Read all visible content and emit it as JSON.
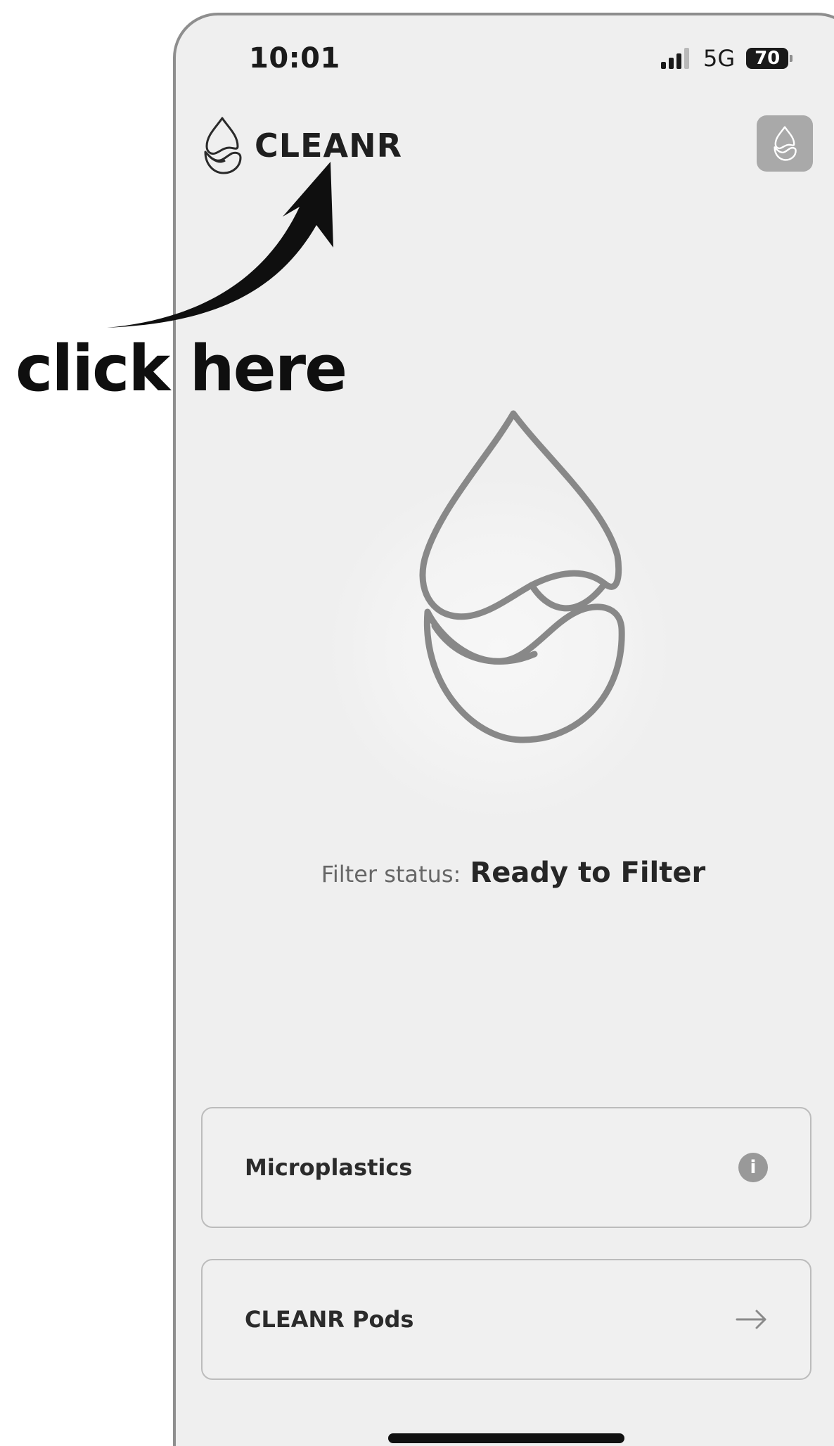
{
  "status_bar": {
    "time": "10:01",
    "network": "5G",
    "battery": "70"
  },
  "header": {
    "app_name": "CLEANR",
    "logo_icon": "water-drop-logo-icon",
    "action_icon": "water-drop-logo-icon"
  },
  "hero": {
    "icon": "water-drop-logo-icon"
  },
  "filter": {
    "label": "Filter status:",
    "value": "Ready to Filter"
  },
  "cards": [
    {
      "label": "Microplastics",
      "icon": "info-icon",
      "icon_glyph": "i"
    },
    {
      "label": "CLEANR Pods",
      "icon": "arrow-right-icon"
    }
  ],
  "annotation": {
    "text": "click here"
  },
  "colors": {
    "background": "#efefef",
    "frame": "#8e8e8e",
    "text": "#1f1f1f",
    "muted": "#666666",
    "accent_grey": "#a9a9a9"
  }
}
